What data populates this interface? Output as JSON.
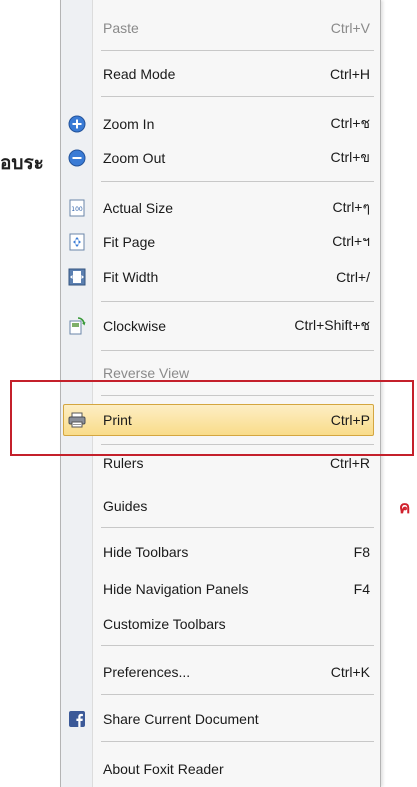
{
  "background": {
    "left_text": "อบระ",
    "right_text": "ค"
  },
  "menu": {
    "items": [
      {
        "label": "Paste",
        "shortcut": "Ctrl+V",
        "disabled": true,
        "icon": null
      },
      {
        "label": "Read Mode",
        "shortcut": "Ctrl+H",
        "icon": null
      },
      {
        "label": "Zoom In",
        "shortcut": "Ctrl+ช",
        "icon": "zoom-in-icon"
      },
      {
        "label": "Zoom Out",
        "shortcut": "Ctrl+ข",
        "icon": "zoom-out-icon"
      },
      {
        "label": "Actual Size",
        "shortcut": "Ctrl+ๆ",
        "icon": "actual-size-icon"
      },
      {
        "label": "Fit Page",
        "shortcut": "Ctrl+ฯ",
        "icon": "fit-page-icon"
      },
      {
        "label": "Fit Width",
        "shortcut": "Ctrl+/",
        "icon": "fit-width-icon"
      },
      {
        "label": "Clockwise",
        "shortcut": "Ctrl+Shift+ช",
        "icon": "rotate-clockwise-icon"
      },
      {
        "label": "Reverse View",
        "shortcut": "",
        "disabled": true,
        "icon": null
      },
      {
        "label": "Print",
        "shortcut": "Ctrl+P",
        "icon": "printer-icon",
        "highlighted": true
      },
      {
        "label": "Rulers",
        "shortcut": "Ctrl+R",
        "icon": null
      },
      {
        "label": "Guides",
        "shortcut": "",
        "icon": null
      },
      {
        "label": "Hide Toolbars",
        "shortcut": "F8",
        "icon": null
      },
      {
        "label": "Hide Navigation Panels",
        "shortcut": "F4",
        "icon": null
      },
      {
        "label": "Customize Toolbars",
        "shortcut": "",
        "icon": null
      },
      {
        "label": "Preferences...",
        "shortcut": "Ctrl+K",
        "icon": null
      },
      {
        "label": "Share Current Document",
        "shortcut": "",
        "icon": "facebook-icon"
      },
      {
        "label": "About Foxit Reader",
        "shortcut": "",
        "icon": null
      }
    ]
  },
  "colors": {
    "highlight_border": "#d4a640",
    "callout_border": "#c4202b",
    "zoom_icon": "#3a7bd5",
    "facebook": "#3b5998"
  }
}
